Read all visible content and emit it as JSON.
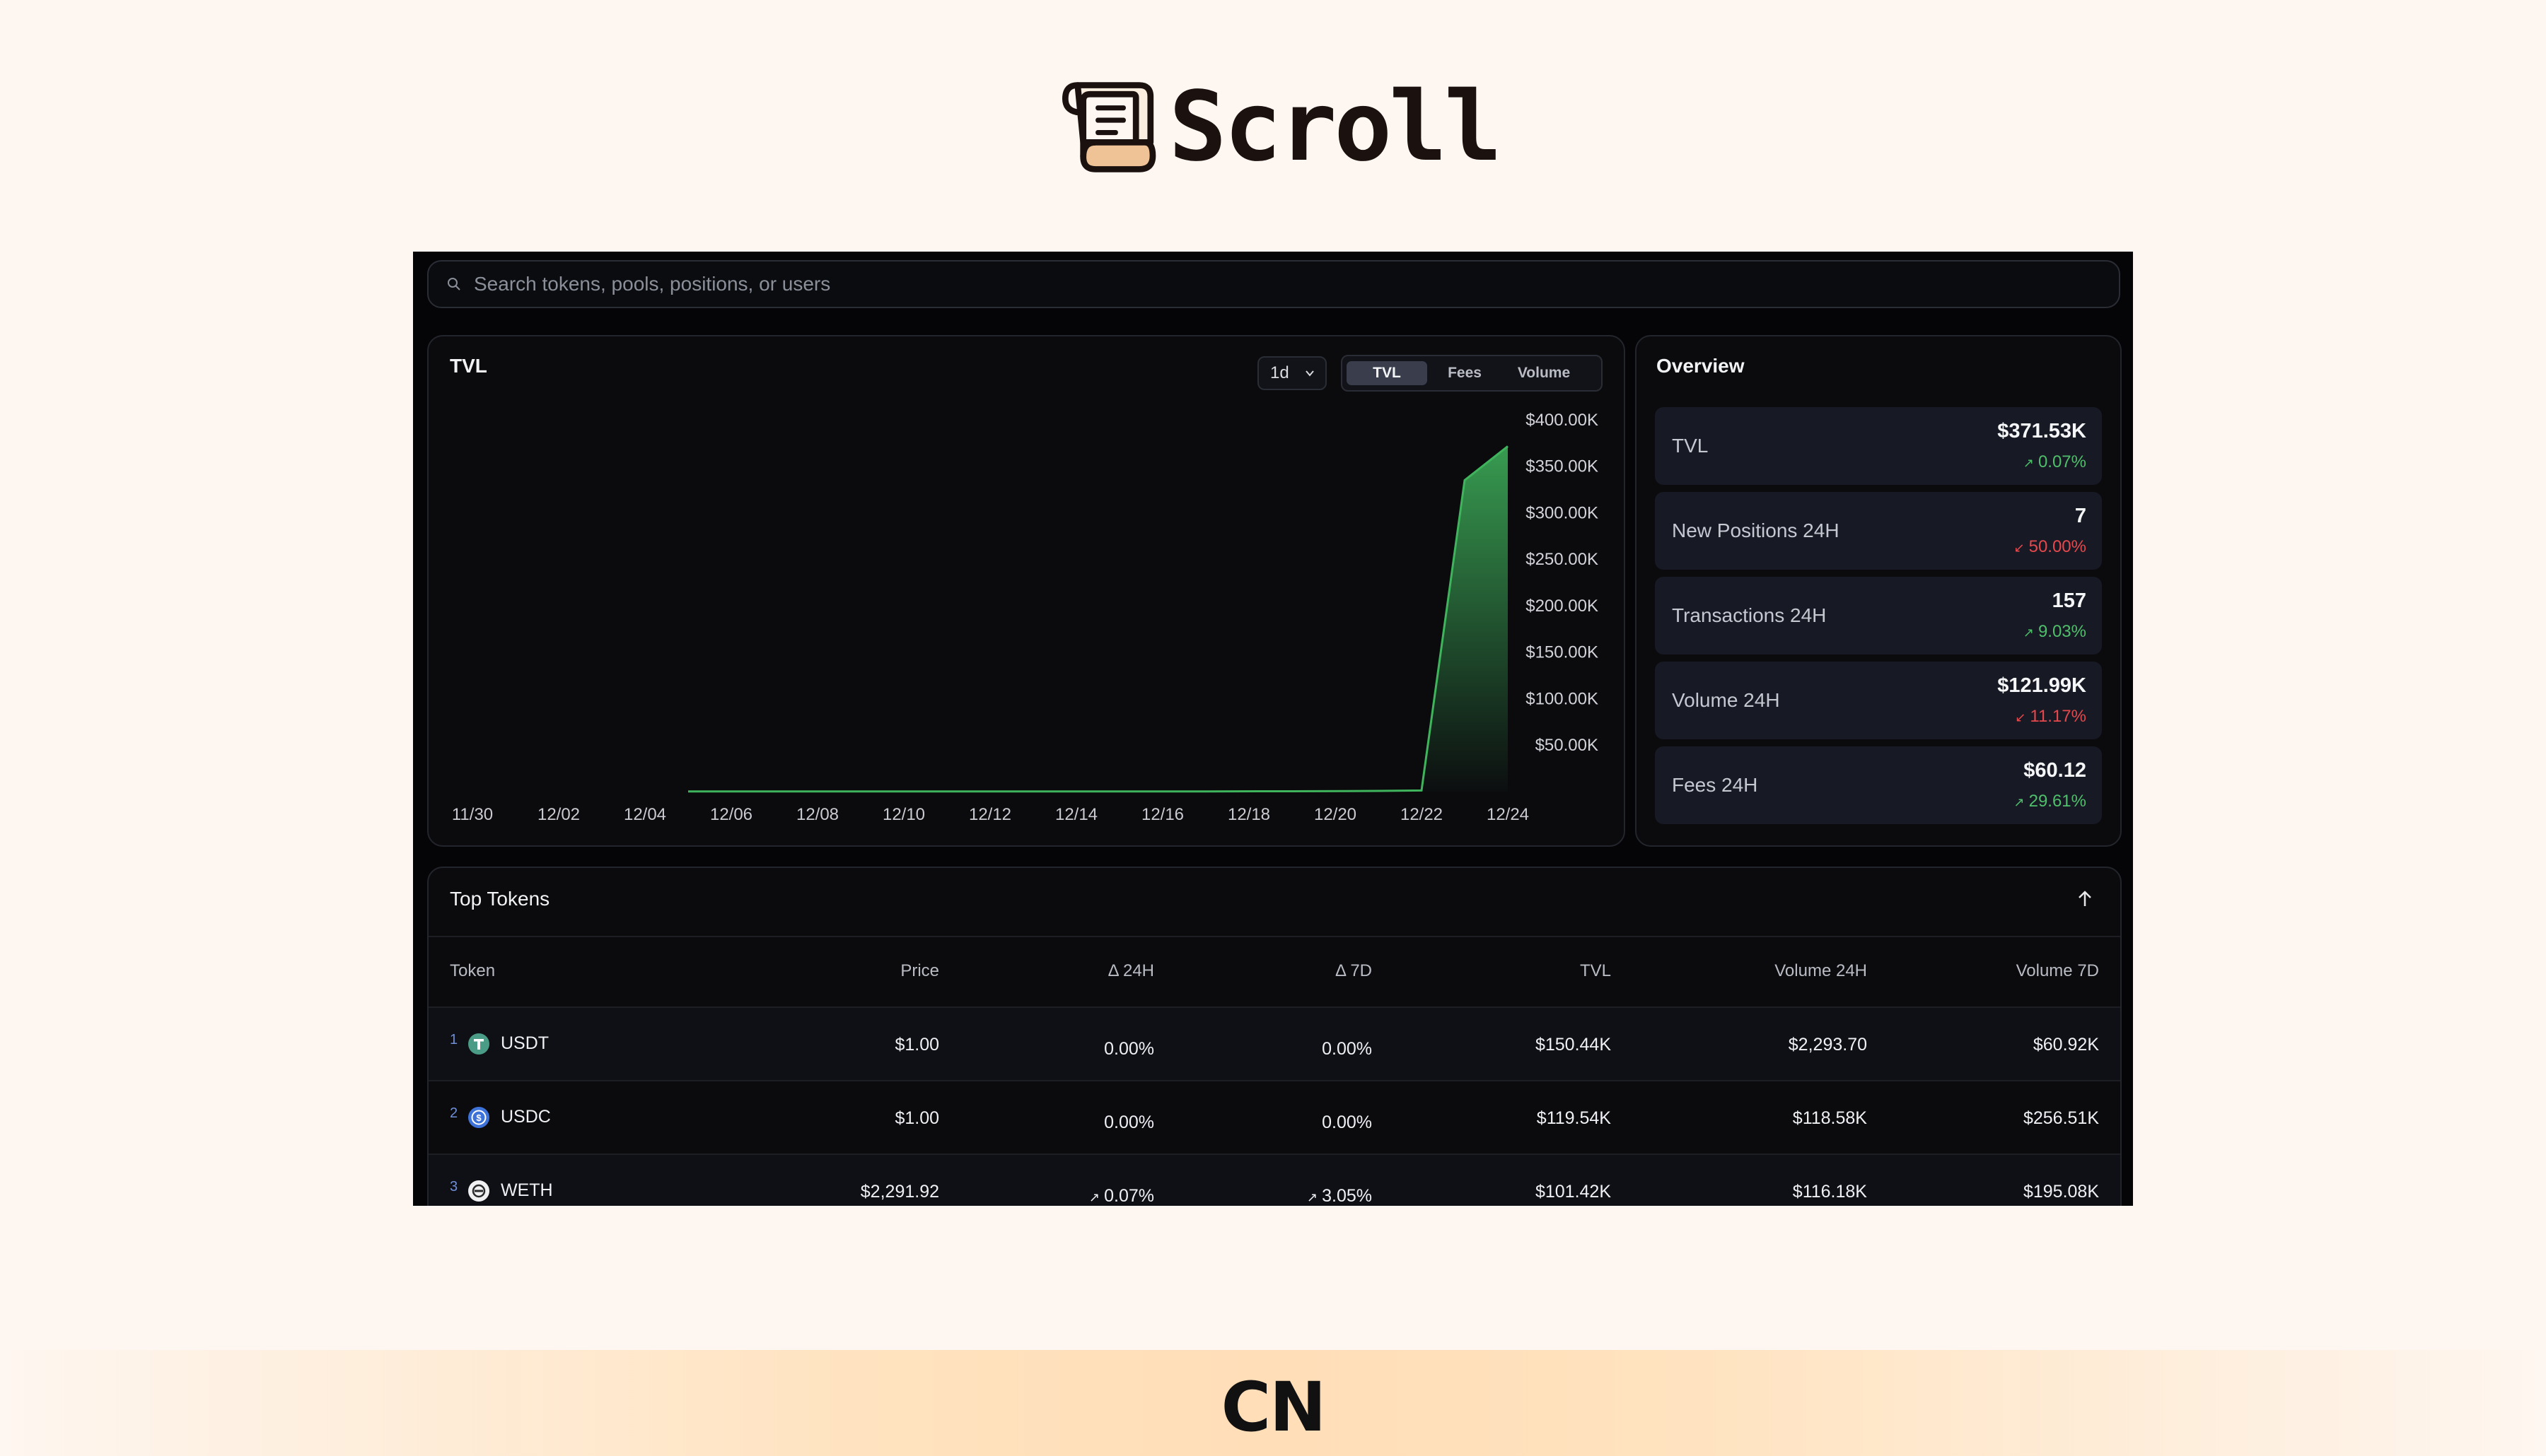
{
  "brand": {
    "name": "Scroll"
  },
  "footer": {
    "label": "CN"
  },
  "search": {
    "placeholder": "Search tokens, pools, positions, or users"
  },
  "tvl_chart": {
    "title": "TVL",
    "range": "1d",
    "tabs": [
      "TVL",
      "Fees",
      "Volume"
    ],
    "active_tab": "TVL",
    "accent": "#3fb45c"
  },
  "chart_data": {
    "type": "area",
    "title": "TVL",
    "x_ticks": [
      "11/30",
      "12/02",
      "12/04",
      "12/06",
      "12/08",
      "12/10",
      "12/12",
      "12/14",
      "12/16",
      "12/18",
      "12/20",
      "12/22",
      "12/24"
    ],
    "y_ticks": [
      "$400.00K",
      "$350.00K",
      "$300.00K",
      "$250.00K",
      "$200.00K",
      "$150.00K",
      "$100.00K",
      "$50.00K"
    ],
    "ylim": [
      0,
      400000
    ],
    "series": [
      {
        "x": [
          "12/04",
          "12/06",
          "12/08",
          "12/10",
          "12/12",
          "12/14",
          "12/16",
          "12/18",
          "12/20",
          "12/21",
          "12/22",
          "12/23"
        ],
        "values": [
          0,
          0,
          0,
          0,
          0,
          0,
          0,
          200,
          500,
          1000,
          335000,
          371530
        ]
      }
    ],
    "grid": false,
    "legend": "none"
  },
  "overview": {
    "title": "Overview",
    "stats": [
      {
        "label": "TVL",
        "value": "$371.53K",
        "change": "0.07%",
        "trend": "up"
      },
      {
        "label": "New Positions 24H",
        "value": "7",
        "change": "50.00%",
        "trend": "down"
      },
      {
        "label": "Transactions 24H",
        "value": "157",
        "change": "9.03%",
        "trend": "up"
      },
      {
        "label": "Volume 24H",
        "value": "$121.99K",
        "change": "11.17%",
        "trend": "down"
      },
      {
        "label": "Fees 24H",
        "value": "$60.12",
        "change": "29.61%",
        "trend": "up"
      }
    ]
  },
  "top_tokens": {
    "title": "Top Tokens",
    "columns": [
      "Token",
      "Price",
      "Δ 24H",
      "Δ 7D",
      "TVL",
      "Volume 24H",
      "Volume 7D"
    ],
    "rows": [
      {
        "rank": "1",
        "symbol": "USDT",
        "icon": "tether-icon",
        "price": "$1.00",
        "d24h": "0.00%",
        "d7d": "0.00%",
        "tvl": "$150.44K",
        "vol24h": "$2,293.70",
        "vol7d": "$60.92K"
      },
      {
        "rank": "2",
        "symbol": "USDC",
        "icon": "usdc-icon",
        "price": "$1.00",
        "d24h": "0.00%",
        "d7d": "0.00%",
        "tvl": "$119.54K",
        "vol24h": "$118.58K",
        "vol7d": "$256.51K"
      },
      {
        "rank": "3",
        "symbol": "WETH",
        "icon": "eth-icon",
        "price": "$2,291.92",
        "d24h": "0.07%",
        "d7d": "3.05%",
        "tvl": "$101.42K",
        "vol24h": "$116.18K",
        "vol7d": "$195.08K"
      }
    ]
  }
}
